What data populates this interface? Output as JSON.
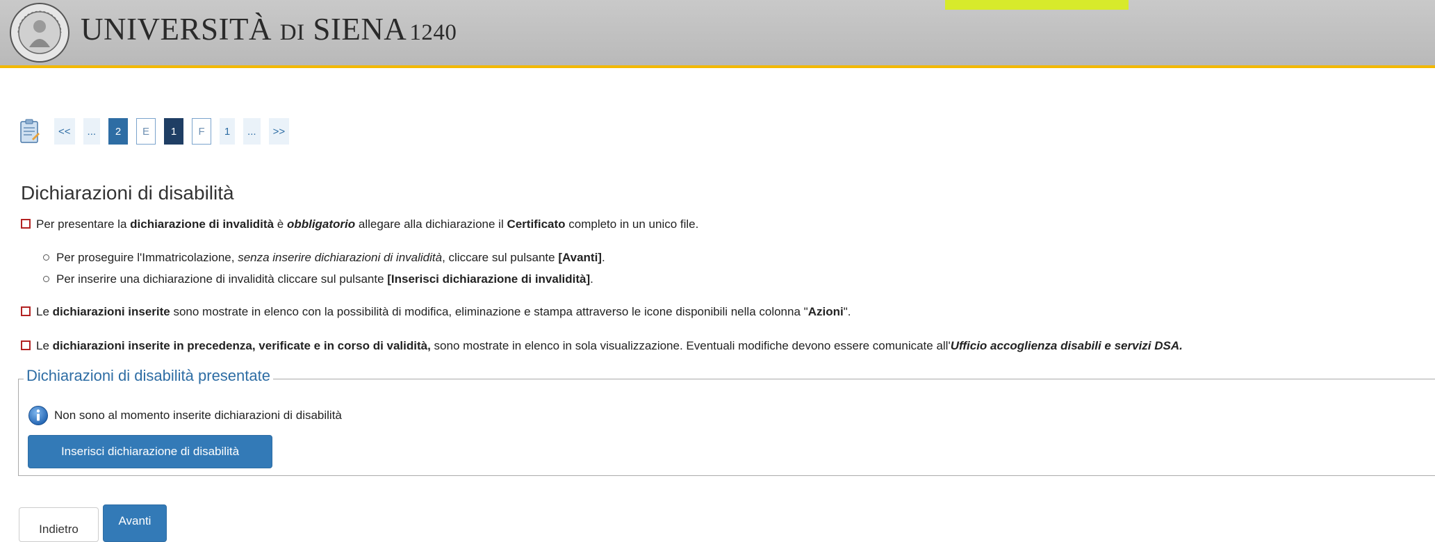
{
  "header": {
    "logo_main": "UNIVERSITÀ",
    "logo_di": "DI",
    "logo_city": "SIENA",
    "logo_year": "1240"
  },
  "pager": {
    "items": [
      "<<",
      "...",
      "2",
      "E",
      "1",
      "F",
      "1",
      "...",
      ">>"
    ]
  },
  "page_title": "Dichiarazioni di disabilità",
  "paragraphs": {
    "p1": {
      "a": "Per presentare la ",
      "b": "dichiarazione di invalidità",
      "c": " è ",
      "d": "obbligatorio",
      "e": " allegare alla dichiarazione il ",
      "f": "Certificato",
      "g": " completo in un unico file."
    },
    "sub1": {
      "a": "Per proseguire l'Immatricolazione, ",
      "b": "senza inserire dichiarazioni di invalidità",
      "c": ", cliccare sul pulsante ",
      "d": "[Avanti]",
      "e": "."
    },
    "sub2": {
      "a": "Per inserire una dichiarazione di invalidità cliccare sul pulsante ",
      "b": "[Inserisci dichiarazione di invalidità]",
      "c": "."
    },
    "p2": {
      "a": "Le ",
      "b": "dichiarazioni inserite",
      "c": " sono mostrate in elenco con la possibilità di modifica, eliminazione e stampa attraverso le icone disponibili nella colonna \"",
      "d": "Azioni",
      "e": "\"."
    },
    "p3": {
      "a": "Le ",
      "b": "dichiarazioni inserite in precedenza, verificate e in corso di validità,",
      "c": " sono mostrate in elenco in sola visualizzazione. Eventuali modifiche devono essere comunicate all'",
      "d": "Ufficio accoglienza disabili e servizi DSA."
    }
  },
  "fieldset": {
    "legend": "Dichiarazioni di disabilità presentate",
    "info_text": "Non sono al momento inserite dichiarazioni di disabilità",
    "insert_button": "Inserisci dichiarazione di disabilità"
  },
  "nav": {
    "back_label": "Indietro",
    "next_label": "Avanti"
  },
  "colors": {
    "header_bar": "#bdbdbd",
    "header_border": "#f2b800",
    "accent_strip": "#d7ea2b",
    "primary": "#337ab7",
    "active_page": "#1f3e64",
    "bullet_square": "#b32222"
  }
}
